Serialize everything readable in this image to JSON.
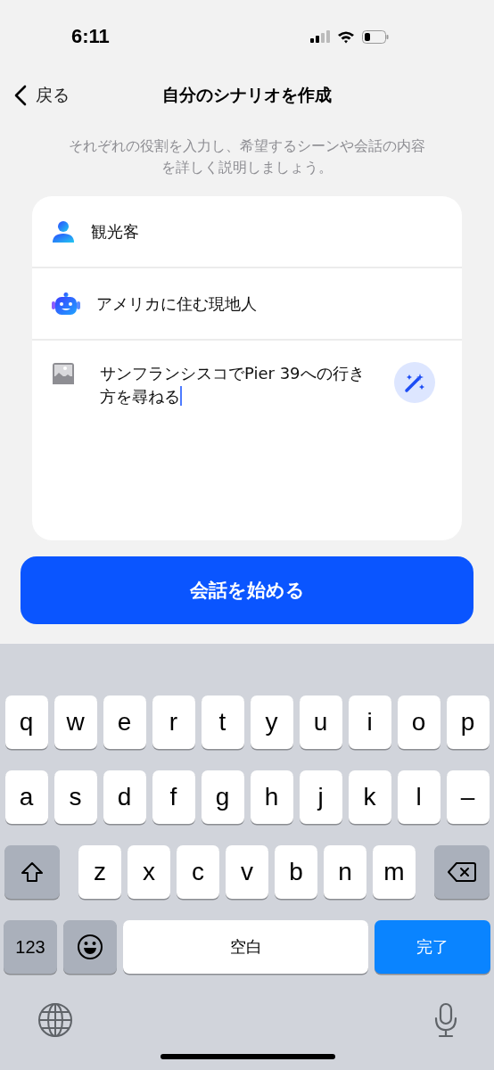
{
  "status_bar": {
    "time": "6:11"
  },
  "nav": {
    "back": "戻る",
    "title": "自分のシナリオを作成"
  },
  "instructions": "それぞれの役割を入力し、希望するシーンや会話の内容を詳しく説明しましょう。",
  "fields": [
    {
      "kind": "user",
      "value": "観光客"
    },
    {
      "kind": "ai",
      "value": "アメリカに住む現地人"
    },
    {
      "kind": "scene",
      "value": "サンフランシスコでPier 39への行き方を尋ねる",
      "focused": true
    }
  ],
  "start_button": "会話を始める",
  "keyboard": {
    "top_row": [
      {
        "kind": "letter",
        "label": "q"
      },
      {
        "kind": "letter",
        "label": "w"
      },
      {
        "kind": "letter",
        "label": "e"
      },
      {
        "kind": "letter",
        "label": "r"
      },
      {
        "kind": "letter",
        "label": "t"
      },
      {
        "kind": "letter",
        "label": "y"
      },
      {
        "kind": "letter",
        "label": "u"
      },
      {
        "kind": "letter",
        "label": "i"
      },
      {
        "kind": "letter",
        "label": "o"
      },
      {
        "kind": "letter",
        "label": "p"
      }
    ],
    "middle_row": [
      {
        "kind": "letter",
        "label": "a"
      },
      {
        "kind": "letter",
        "label": "s"
      },
      {
        "kind": "letter",
        "label": "d"
      },
      {
        "kind": "letter",
        "label": "f"
      },
      {
        "kind": "letter",
        "label": "g"
      },
      {
        "kind": "letter",
        "label": "h"
      },
      {
        "kind": "letter",
        "label": "j"
      },
      {
        "kind": "letter",
        "label": "k"
      },
      {
        "kind": "letter",
        "label": "l"
      },
      {
        "kind": "letter",
        "label": "–"
      }
    ],
    "third_row": [
      {
        "kind": "shift"
      },
      {
        "kind": "letter",
        "label": "z"
      },
      {
        "kind": "letter",
        "label": "x"
      },
      {
        "kind": "letter",
        "label": "c"
      },
      {
        "kind": "letter",
        "label": "v"
      },
      {
        "kind": "letter",
        "label": "b"
      },
      {
        "kind": "letter",
        "label": "n"
      },
      {
        "kind": "letter",
        "label": "m"
      },
      {
        "kind": "delete"
      }
    ],
    "bottom_row": [
      {
        "kind": "mode",
        "label": "123"
      },
      {
        "kind": "emoji"
      },
      {
        "kind": "space",
        "label": "空白"
      },
      {
        "kind": "done",
        "label": "完了"
      }
    ]
  }
}
